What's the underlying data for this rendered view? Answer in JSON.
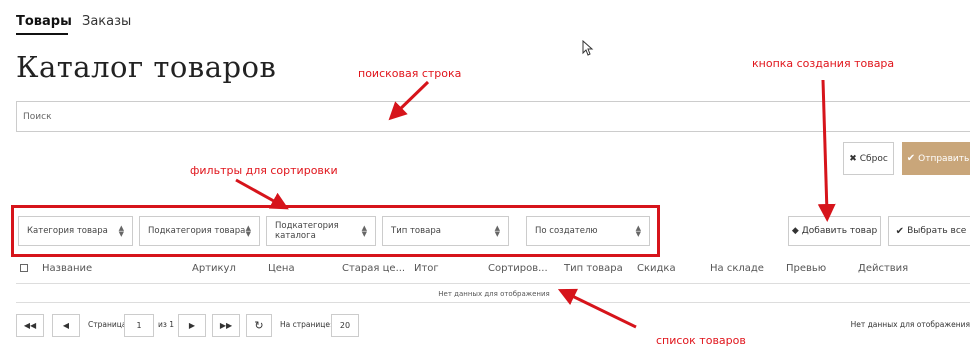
{
  "tabs": [
    {
      "label": "Товары",
      "active": true
    },
    {
      "label": "Заказы",
      "active": false
    }
  ],
  "page_title": "Каталог товаров",
  "annotations": {
    "search": "поисковая строка",
    "create_button": "кнопка создания товара",
    "filters": "фильтры для сортировки",
    "list": "список товаров"
  },
  "search": {
    "placeholder": "Поиск",
    "value": ""
  },
  "actions": {
    "reset": "Сброс",
    "submit": "Отправить",
    "add": "Добавить товар",
    "select_all": "Выбрать все"
  },
  "filters": [
    "Категория товара",
    "Подкатегория товара",
    "Подкатегория каталога",
    "Тип товара",
    "По создателю"
  ],
  "table": {
    "columns": [
      "Название",
      "Артикул",
      "Цена",
      "Старая це...",
      "Итог",
      "Сортиров...",
      "Тип товара",
      "Скидка",
      "На складе",
      "Превью",
      "Действия"
    ],
    "empty_text": "Нет данных для отображения"
  },
  "pagination": {
    "page_label": "Страница",
    "page": "1",
    "of_label": "из 1",
    "per_page_label": "На странице:",
    "per_page": "20",
    "status": "Нет данных для отображения"
  },
  "colors": {
    "accent": "#c9a67a",
    "annotation": "#e0141b"
  }
}
